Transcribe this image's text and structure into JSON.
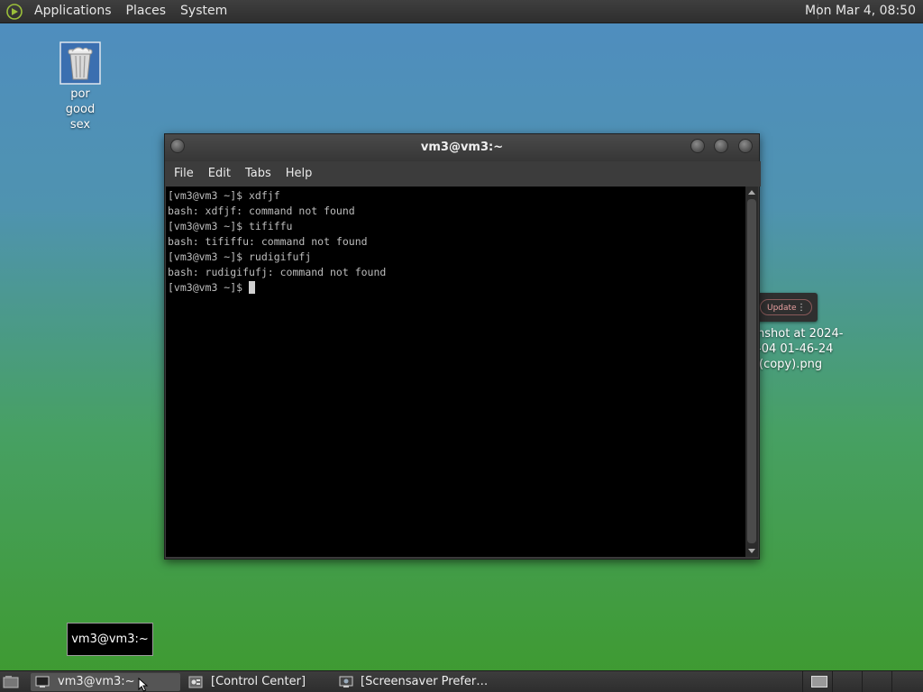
{
  "top_panel": {
    "menus": [
      "Applications",
      "Places",
      "System"
    ],
    "clock": "Mon Mar  4, 08:50"
  },
  "desktop": {
    "trash_label": [
      "por",
      "good",
      "sex"
    ],
    "screenshot_label": [
      "enshot at 2024-",
      "-04 01-46-24",
      "(copy).png"
    ],
    "update_widget_label": "Update"
  },
  "terminal": {
    "title": "vm3@vm3:~",
    "menus": [
      "File",
      "Edit",
      "Tabs",
      "Help"
    ],
    "lines": [
      "[vm3@vm3 ~]$ xdfjf",
      "bash: xdfjf: command not found",
      "[vm3@vm3 ~]$ tififfu",
      "bash: tififfu: command not found",
      "[vm3@vm3 ~]$ rudigifufj",
      "bash: rudigifufj: command not found"
    ],
    "prompt": "[vm3@vm3 ~]$ "
  },
  "tooltip": "vm3@vm3:~",
  "taskbar": {
    "tasks": [
      {
        "label": "vm3@vm3:~",
        "icon": "terminal-icon",
        "active": true
      },
      {
        "label": "[Control Center]",
        "icon": "control-center-icon",
        "active": false
      },
      {
        "label": "[Screensaver Prefer…",
        "icon": "screensaver-icon",
        "active": false
      }
    ]
  }
}
